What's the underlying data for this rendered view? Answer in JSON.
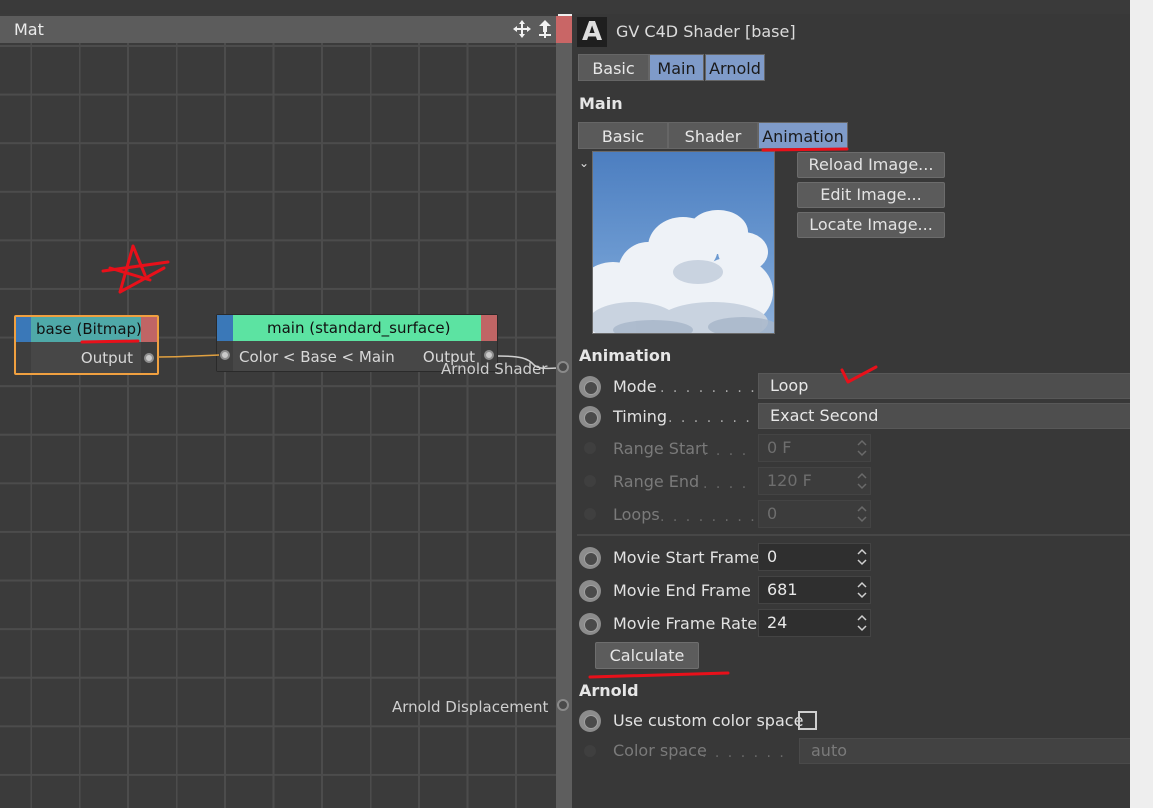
{
  "node_editor": {
    "title": "Mat",
    "nodes": {
      "base": {
        "title": "base (Bitmap)",
        "output_label": "Output"
      },
      "main": {
        "title": "main (standard_surface)",
        "input_label": "Color < Base < Main",
        "output_label": "Output"
      }
    },
    "ports": {
      "arnold_shader": "Arnold Shader",
      "arnold_displacement": "Arnold Displacement"
    }
  },
  "attributes": {
    "logo_letter": "A",
    "title": "GV C4D Shader [base]",
    "top_tabs": [
      "Basic",
      "Main",
      "Arnold"
    ],
    "top_tabs_active": "Main",
    "main_section": "Main",
    "sub_tabs": [
      "Basic",
      "Shader",
      "Animation"
    ],
    "sub_tabs_active": "Animation",
    "image_buttons": {
      "reload": "Reload Image...",
      "edit": "Edit Image...",
      "locate": "Locate Image..."
    },
    "animation_section": "Animation",
    "mode": {
      "label": "Mode",
      "value": "Loop"
    },
    "timing": {
      "label": "Timing",
      "value": "Exact Second"
    },
    "range_start": {
      "label": "Range Start",
      "value": "0 F"
    },
    "range_end": {
      "label": "Range End",
      "value": "120 F"
    },
    "loops": {
      "label": "Loops",
      "value": "0"
    },
    "movie_start_frame": {
      "label": "Movie Start Frame",
      "value": "0"
    },
    "movie_end_frame": {
      "label": "Movie End Frame",
      "value": "681"
    },
    "movie_frame_rate": {
      "label": "Movie Frame Rate",
      "value": "24"
    },
    "calculate": "Calculate",
    "arnold_section": "Arnold",
    "use_custom_color_space": {
      "label": "Use custom color space",
      "checked": false
    },
    "color_space": {
      "label": "Color space",
      "value": "auto"
    }
  },
  "colors": {
    "base_node_header": "#4fa9a8",
    "main_node_header": "#5ce3a2",
    "selection_outline": "#f0a040",
    "active_tab": "#7f9bc9",
    "annotation_red": "#e8101a"
  }
}
